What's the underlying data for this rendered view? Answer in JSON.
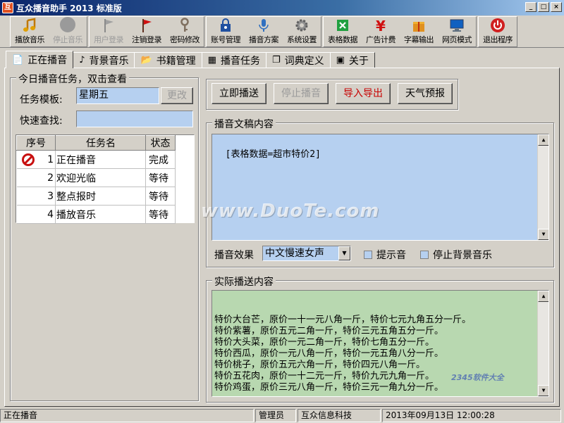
{
  "window": {
    "title": "互众播音助手 2013 标准版",
    "app_icon_text": "互",
    "min": "_",
    "max": "□",
    "close": "×"
  },
  "toolbar": {
    "groups": [
      [
        {
          "label": "播放音乐",
          "icon": "music-note-icon",
          "disabled": false
        },
        {
          "label": "停止音乐",
          "icon": "stop-circle-icon",
          "disabled": true
        }
      ],
      [
        {
          "label": "用户登录",
          "icon": "flag-grey-icon",
          "disabled": true
        },
        {
          "label": "注销登录",
          "icon": "flag-red-icon",
          "disabled": false
        },
        {
          "label": "密码修改",
          "icon": "key-icon",
          "disabled": false
        }
      ],
      [
        {
          "label": "账号管理",
          "icon": "lock-user-icon",
          "disabled": false
        },
        {
          "label": "播音方案",
          "icon": "microphone-icon",
          "disabled": false
        },
        {
          "label": "系统设置",
          "icon": "gear-icon",
          "disabled": false
        }
      ],
      [
        {
          "label": "表格数据",
          "icon": "excel-icon",
          "disabled": false
        },
        {
          "label": "广告计费",
          "icon": "yen-icon",
          "disabled": false
        },
        {
          "label": "字幕输出",
          "icon": "gift-box-icon",
          "disabled": false
        },
        {
          "label": "网页模式",
          "icon": "monitor-icon",
          "disabled": false
        }
      ],
      [
        {
          "label": "退出程序",
          "icon": "power-icon",
          "disabled": false
        }
      ]
    ]
  },
  "tabs": [
    {
      "label": "正在播音",
      "icon": "📄",
      "active": true
    },
    {
      "label": "背景音乐",
      "icon": "♪",
      "active": false
    },
    {
      "label": "书籍管理",
      "icon": "📂",
      "active": false
    },
    {
      "label": "播音任务",
      "icon": "▦",
      "active": false
    },
    {
      "label": "词典定义",
      "icon": "❐",
      "active": false
    },
    {
      "label": "关于",
      "icon": "▣",
      "active": false
    }
  ],
  "today": {
    "group_title": "今日播音任务，双击查看",
    "template_label": "任务模板:",
    "template_value": "星期五",
    "change_button": "更改",
    "search_label": "快速查找:",
    "search_value": "",
    "columns": [
      "序号",
      "任务名",
      "状态"
    ],
    "rows": [
      {
        "num": "1",
        "name": "正在播音",
        "status": "完成",
        "playing": true
      },
      {
        "num": "2",
        "name": "欢迎光临",
        "status": "等待",
        "playing": false
      },
      {
        "num": "3",
        "name": "整点报时",
        "status": "等待",
        "playing": false
      },
      {
        "num": "4",
        "name": "播放音乐",
        "status": "等待",
        "playing": false
      }
    ]
  },
  "actions": {
    "play_now": "立即播送",
    "stop": "停止播音",
    "import_export": "导入导出",
    "weather": "天气预报"
  },
  "script": {
    "group_title": "播音文稿内容",
    "content": "[表格数据=超市特价2]",
    "effect_label": "播音效果",
    "effect_value": "中文慢速女声",
    "prompt_sound": "提示音",
    "stop_bg_music": "停止背景音乐"
  },
  "actual": {
    "group_title": "实际播送内容",
    "lines": [
      "特价大台芒，原价一十一元八角一斤，特价七元九角五分一斤。",
      "特价紫薯，原价五元二角一斤，特价三元五角五分一斤。",
      "特价大头菜，原价一元二角一斤，特价七角五分一斤。",
      "特价西瓜，原价一元八角一斤，特价一元五角八分一斤。",
      "特价桃子，原价五元六角一斤，特价四元八角一斤。",
      "特价五花肉，原价一十二元一斤，特价九元九角一斤。",
      "特价鸡蛋，原价三元八角一斤，特价三元一角九分一斤。"
    ]
  },
  "status": {
    "state": "正在播音",
    "user": "管理员",
    "company": "互众信息科技",
    "datetime": "2013年09月13日 12:00:28"
  },
  "watermark": {
    "main": "www.DuoTe.com",
    "corner": "2345软件大全"
  },
  "colors": {
    "field_bg": "#b6d0f0",
    "script_bg": "#b6d0f0",
    "actual_bg": "#b8d8b0",
    "face": "#d4d0c8"
  }
}
